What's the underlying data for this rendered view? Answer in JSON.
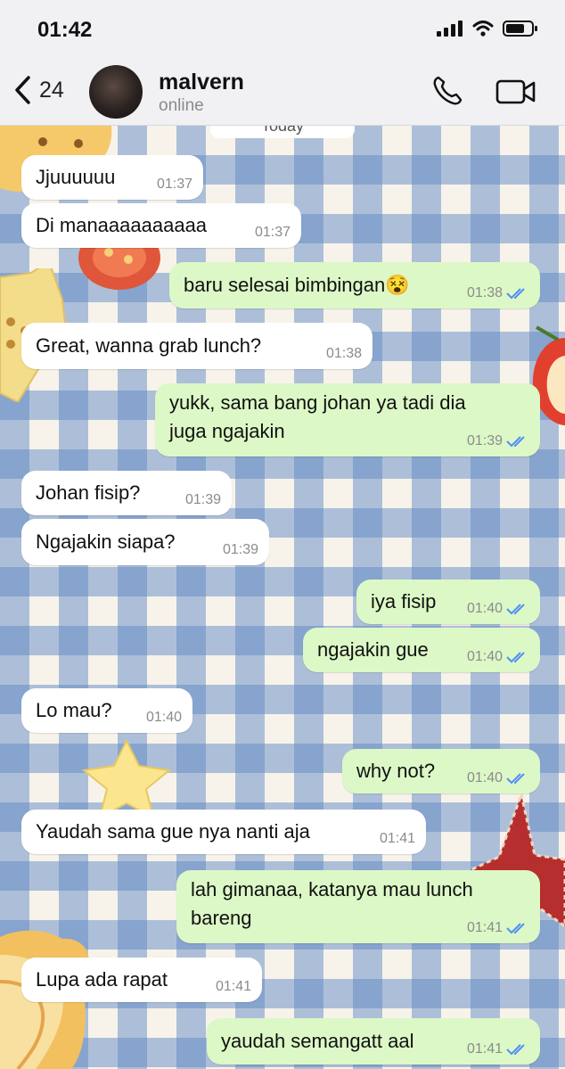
{
  "status_bar": {
    "time": "01:42"
  },
  "header": {
    "back_count": "24",
    "contact_name": "malvern",
    "contact_status": "online"
  },
  "date_chip": "Today",
  "messages": [
    {
      "dir": "in",
      "text": "Jjuuuuuu",
      "time": "01:37"
    },
    {
      "dir": "in",
      "text": "Di manaaaaaaaaaa",
      "time": "01:37"
    },
    {
      "dir": "out",
      "text": "baru selesai bimbingan😵",
      "time": "01:38",
      "status": "read"
    },
    {
      "dir": "in",
      "text": "Great, wanna grab lunch?",
      "time": "01:38"
    },
    {
      "dir": "out",
      "text": "yukk, sama bang johan ya tadi dia",
      "text2": "juga ngajakin",
      "time": "01:39",
      "status": "read"
    },
    {
      "dir": "in",
      "text": "Johan fisip?",
      "time": "01:39"
    },
    {
      "dir": "in",
      "text": "Ngajakin siapa?",
      "time": "01:39"
    },
    {
      "dir": "out",
      "text": "iya fisip",
      "time": "01:40",
      "status": "read"
    },
    {
      "dir": "out",
      "text": "ngajakin gue",
      "time": "01:40",
      "status": "read"
    },
    {
      "dir": "in",
      "text": "Lo mau?",
      "time": "01:40"
    },
    {
      "dir": "out",
      "text": "why not?",
      "time": "01:40",
      "status": "read"
    },
    {
      "dir": "in",
      "text": "Yaudah sama gue nya nanti aja",
      "time": "01:41"
    },
    {
      "dir": "out",
      "text": "lah gimanaa, katanya mau lunch",
      "text2": "bareng",
      "time": "01:41",
      "status": "read"
    },
    {
      "dir": "in",
      "text": "Lupa ada rapat",
      "time": "01:41"
    },
    {
      "dir": "out",
      "text": "yaudah semangatt aal",
      "time": "01:41",
      "status": "read"
    }
  ],
  "colors": {
    "outgoing_bubble": "#dcf8c6",
    "incoming_bubble": "#ffffff",
    "read_tick": "#4f8ff7",
    "check_pattern": "#5c86c4"
  },
  "icons": {
    "back": "chevron-left-icon",
    "call": "phone-icon",
    "video": "video-camera-icon",
    "read_receipt": "double-check-icon"
  }
}
